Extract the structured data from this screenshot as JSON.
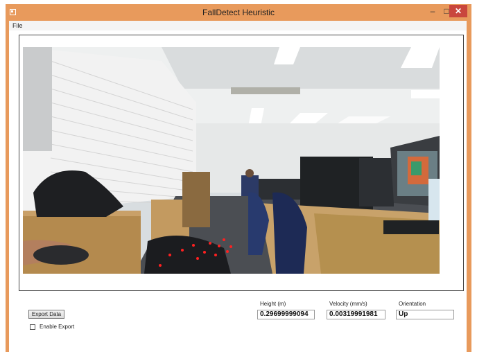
{
  "window": {
    "title": "FallDetect Heuristic"
  },
  "menu": {
    "file": "File"
  },
  "controls": {
    "export_button": "Export Data",
    "enable_export_label": "Enable Export",
    "enable_export_checked": false
  },
  "fields": {
    "height_label": "Height (m)",
    "height_value": "0.29699999094",
    "velocity_label": "Velocity (mm/s)",
    "velocity_value": "0.00319991981",
    "orientation_label": "Orientation",
    "orientation_value": "Up"
  },
  "colors": {
    "titlebar": "#e89a5c",
    "close_button": "#c9463d",
    "tracking_points": "#ff2020"
  }
}
